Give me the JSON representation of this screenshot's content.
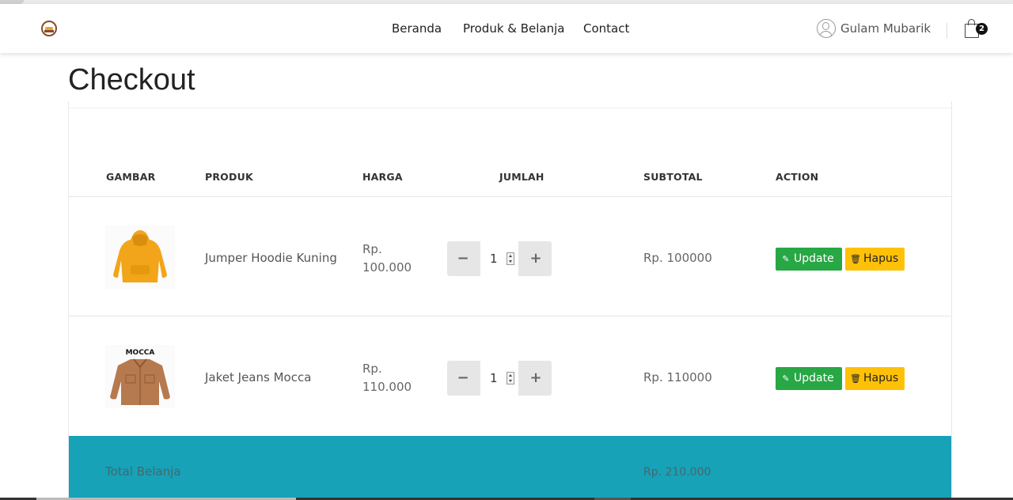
{
  "nav": {
    "links": [
      "Beranda",
      "Produk & Belanja",
      "Contact"
    ],
    "user_name": "Gulam Mubarik",
    "cart_count": "2"
  },
  "page_title": "Checkout",
  "table": {
    "headers": [
      "GAMBAR",
      "PRODUK",
      "HARGA",
      "JUMLAH",
      "SUBTOTAL",
      "ACTION"
    ],
    "rows": [
      {
        "image_label": "",
        "product": "Jumper Hoodie Kuning",
        "price": "Rp. 100.000",
        "qty": "1",
        "subtotal": "Rp. 100000",
        "update_label": "Update",
        "delete_label": "Hapus"
      },
      {
        "image_label": "MOCCA",
        "product": "Jaket Jeans Mocca",
        "price": "Rp. 110.000",
        "qty": "1",
        "subtotal": "Rp. 110000",
        "update_label": "Update",
        "delete_label": "Hapus"
      }
    ],
    "qty_minus": "−",
    "qty_plus": "+"
  },
  "total": {
    "label": "Total Belanja",
    "value": "Rp. 210.000"
  },
  "colors": {
    "total_bar": "#17a2b8",
    "update_button": "#28a745",
    "delete_button": "#ffc107"
  },
  "icons": [
    "user-icon",
    "shopping-bag-icon",
    "edit-icon",
    "trash-icon",
    "store-logo"
  ]
}
